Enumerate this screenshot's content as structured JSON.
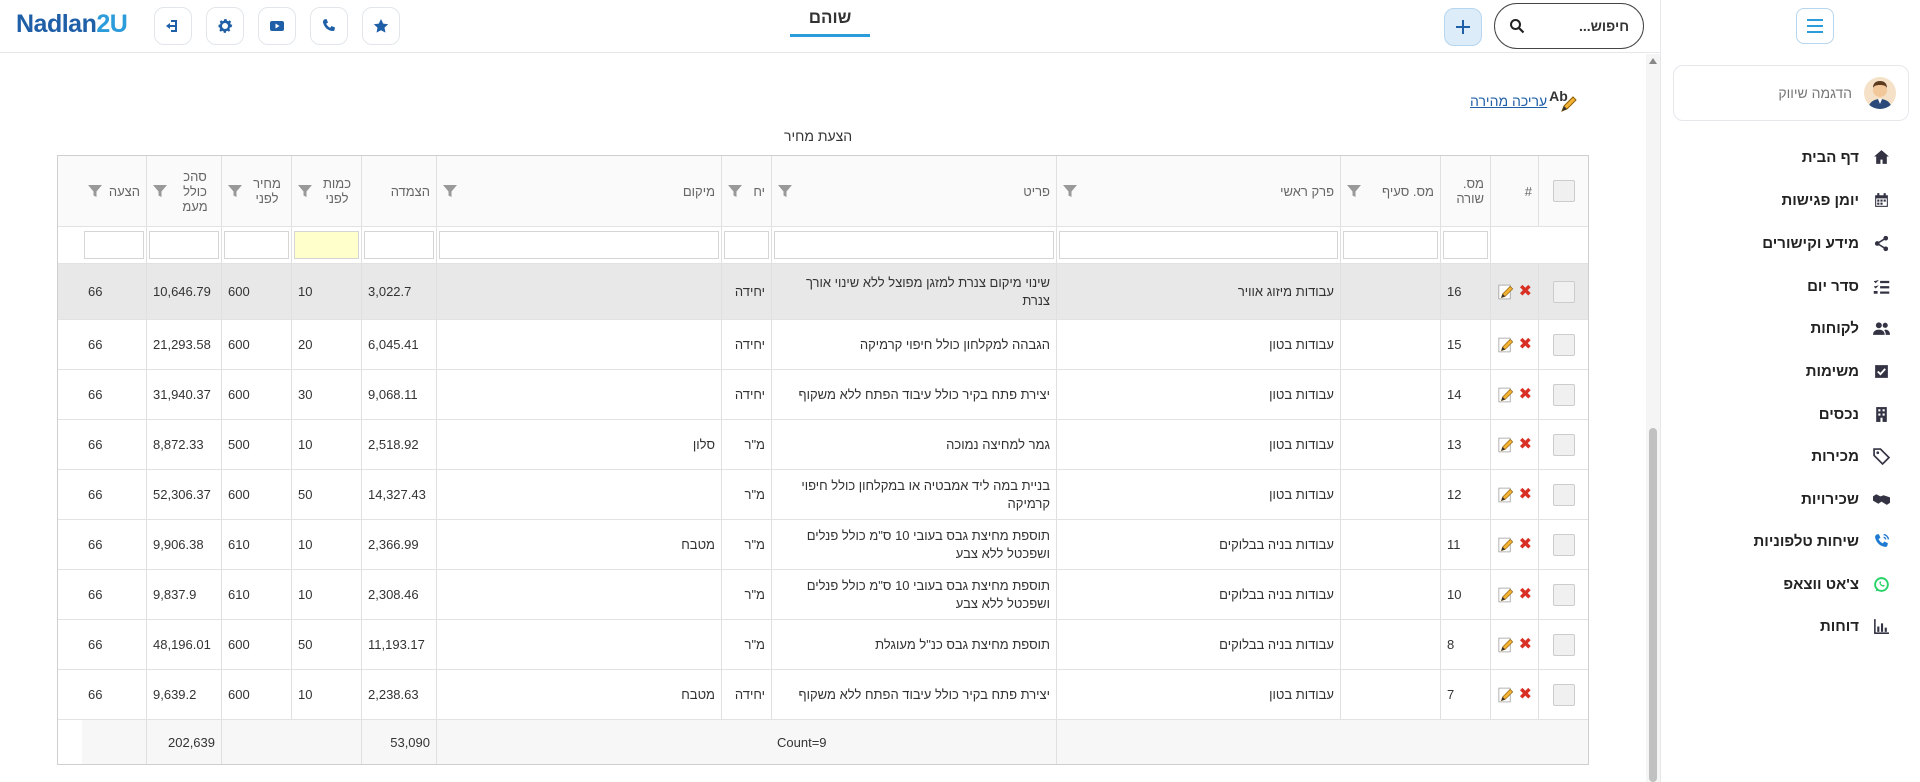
{
  "header": {
    "logo_main": "Nadlan",
    "logo_num": "2U",
    "page_title": "שוהם",
    "search_placeholder": "חיפוש..."
  },
  "sidebar": {
    "user_name": "הדגמה שיווק",
    "items": [
      {
        "label": "דף הבית",
        "icon": "home-icon"
      },
      {
        "label": "יומן פגישות",
        "icon": "calendar-icon"
      },
      {
        "label": "מידע וקישורים",
        "icon": "share-icon"
      },
      {
        "label": "סדר יום",
        "icon": "checklist-icon"
      },
      {
        "label": "לקוחות",
        "icon": "users-icon"
      },
      {
        "label": "משימות",
        "icon": "checkbox-icon"
      },
      {
        "label": "נכסים",
        "icon": "building-icon"
      },
      {
        "label": "מכירות",
        "icon": "tag-icon"
      },
      {
        "label": "שכירויות",
        "icon": "handshake-icon"
      },
      {
        "label": "שיחות טלפוניות",
        "icon": "phone-icon"
      },
      {
        "label": "צ'אט ווצאפ",
        "icon": "whatsapp-icon"
      },
      {
        "label": "דוחות",
        "icon": "chart-icon"
      }
    ]
  },
  "main": {
    "quick_edit": "עריכה מהירה",
    "quick_edit_icon_text": "Ab",
    "caption": "הצעת מחיר",
    "columns": {
      "hash": "#",
      "row_no": "מס. שורה",
      "section_no": "מס. סעיף",
      "chapter": "פרק ראשי",
      "item": "פריט",
      "unit": "יח",
      "location": "מיקום",
      "indexation": "הצמדה",
      "qty_before": "כמות לפני",
      "price_before": "מחיר לפני",
      "total_vat": "סהכ כולל מעמ",
      "offer": "הצעה"
    },
    "rows": [
      {
        "row_no": "16",
        "chapter": "עבודות מיזוג אוויר",
        "item": "שינוי מיקום צנרת למזגן מפוצל ללא שינוי אורך צנרת",
        "unit": "יחידה",
        "location": "",
        "indexation": "3,022.7",
        "qty": "10",
        "price": "600",
        "total": "10,646.79",
        "offer": "66"
      },
      {
        "row_no": "15",
        "chapter": "עבודות בטון",
        "item": "הגבהה למקלחון כולל חיפוי קרמיקה",
        "unit": "יחידה",
        "location": "",
        "indexation": "6,045.41",
        "qty": "20",
        "price": "600",
        "total": "21,293.58",
        "offer": "66"
      },
      {
        "row_no": "14",
        "chapter": "עבודות בטון",
        "item": "יצירת פתח בקיר כולל עיבוד הפתח ללא משקוף",
        "unit": "יחידה",
        "location": "",
        "indexation": "9,068.11",
        "qty": "30",
        "price": "600",
        "total": "31,940.37",
        "offer": "66"
      },
      {
        "row_no": "13",
        "chapter": "עבודות בטון",
        "item": "גמר למחיצה נמוכה",
        "unit": "מ\"ר",
        "location": "סלון",
        "indexation": "2,518.92",
        "qty": "10",
        "price": "500",
        "total": "8,872.33",
        "offer": "66"
      },
      {
        "row_no": "12",
        "chapter": "עבודות בטון",
        "item": "בניית במה ליד אמבטיה או במקלחון כולל חיפוי קרמיקה",
        "unit": "מ\"ר",
        "location": "",
        "indexation": "14,327.43",
        "qty": "50",
        "price": "600",
        "total": "52,306.37",
        "offer": "66"
      },
      {
        "row_no": "11",
        "chapter": "עבודות בניה בבלוקים",
        "item": "תוספת מחיצת גבס בעובי 10 ס\"מ כולל פנלים ושפכטל ללא צבע",
        "unit": "מ\"ר",
        "location": "מטבח",
        "indexation": "2,366.99",
        "qty": "10",
        "price": "610",
        "total": "9,906.38",
        "offer": "66"
      },
      {
        "row_no": "10",
        "chapter": "עבודות בניה בבלוקים",
        "item": "תוספת מחיצת גבס בעובי 10 ס\"מ כולל פנלים ושפכטל ללא צבע",
        "unit": "מ\"ר",
        "location": "",
        "indexation": "2,308.46",
        "qty": "10",
        "price": "610",
        "total": "9,837.9",
        "offer": "66"
      },
      {
        "row_no": "8",
        "chapter": "עבודות בניה בבלוקים",
        "item": "תוספת מחיצת גבס כנ\"ל מעוגלת",
        "unit": "מ\"ר",
        "location": "",
        "indexation": "11,193.17",
        "qty": "50",
        "price": "600",
        "total": "48,196.01",
        "offer": "66"
      },
      {
        "row_no": "7",
        "chapter": "עבודות בטון",
        "item": "יצירת פתח בקיר כולל עיבוד הפתח ללא משקוף",
        "unit": "יחידה",
        "location": "מטבח",
        "indexation": "2,238.63",
        "qty": "10",
        "price": "600",
        "total": "9,639.2",
        "offer": "66"
      }
    ],
    "footer": {
      "count": "Count=9",
      "indexation_sum": "53,090",
      "total_sum": "202,639"
    }
  }
}
